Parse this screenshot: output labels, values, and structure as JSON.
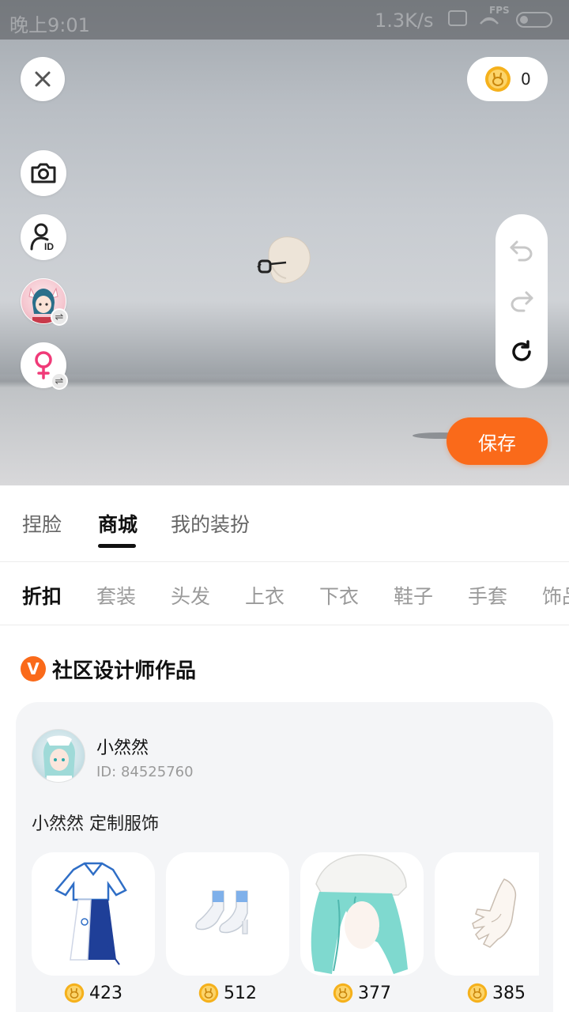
{
  "status_bar": {
    "time": "晚上9:01",
    "speed": "1.3K/s",
    "fps": "FPS"
  },
  "scene": {
    "coin_balance": "0",
    "save_label": "保存"
  },
  "main_tabs": [
    {
      "label": "捏脸",
      "active": false
    },
    {
      "label": "商城",
      "active": true
    },
    {
      "label": "我的装扮",
      "active": false
    }
  ],
  "category_tabs": [
    {
      "label": "折扣",
      "active": true
    },
    {
      "label": "套装",
      "active": false
    },
    {
      "label": "头发",
      "active": false
    },
    {
      "label": "上衣",
      "active": false
    },
    {
      "label": "下衣",
      "active": false
    },
    {
      "label": "鞋子",
      "active": false
    },
    {
      "label": "手套",
      "active": false
    },
    {
      "label": "饰品",
      "active": false
    }
  ],
  "section": {
    "badge": "V",
    "title": "社区设计师作品"
  },
  "designer": {
    "name": "小然然",
    "id_text": "ID: 84525760",
    "description": "小然然 定制服饰"
  },
  "items": [
    {
      "icon": "outfit-icon",
      "price": "423"
    },
    {
      "icon": "shoes-icon",
      "price": "512"
    },
    {
      "icon": "hair-icon",
      "price": "377"
    },
    {
      "icon": "glove-icon",
      "price": "385"
    }
  ],
  "colors": {
    "accent": "#fa6a1a",
    "coin": "#f5b11c",
    "active_text": "#111111",
    "inactive_text": "#9a9a9a"
  }
}
